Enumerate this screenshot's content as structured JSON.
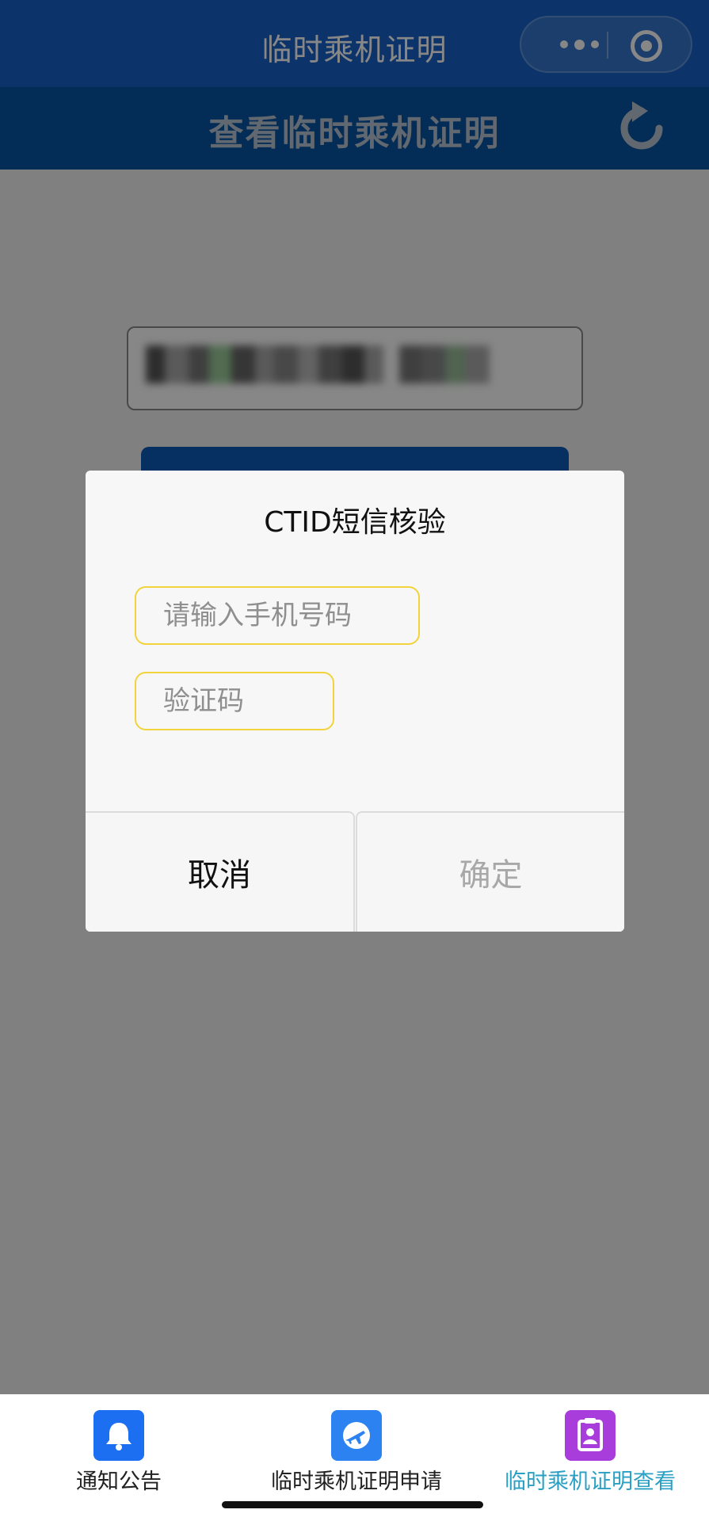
{
  "titlebar": {
    "title": "临时乘机证明"
  },
  "header": {
    "title": "查看临时乘机证明"
  },
  "modal": {
    "title": "CTID短信核验",
    "phone_placeholder": "请输入手机号码",
    "code_placeholder": "验证码",
    "cancel_label": "取消",
    "confirm_label": "确定"
  },
  "tabs": [
    {
      "label": "通知公告",
      "icon": "bell-icon",
      "active": false
    },
    {
      "label": "临时乘机证明申请",
      "icon": "airplane-icon",
      "active": false
    },
    {
      "label": "临时乘机证明查看",
      "icon": "certificate-icon",
      "active": true
    }
  ],
  "colors": {
    "titlebar": "#1a63c8",
    "header": "#0753a3",
    "input_border": "#f2d33b",
    "active_tab": "#2aa0c4"
  }
}
